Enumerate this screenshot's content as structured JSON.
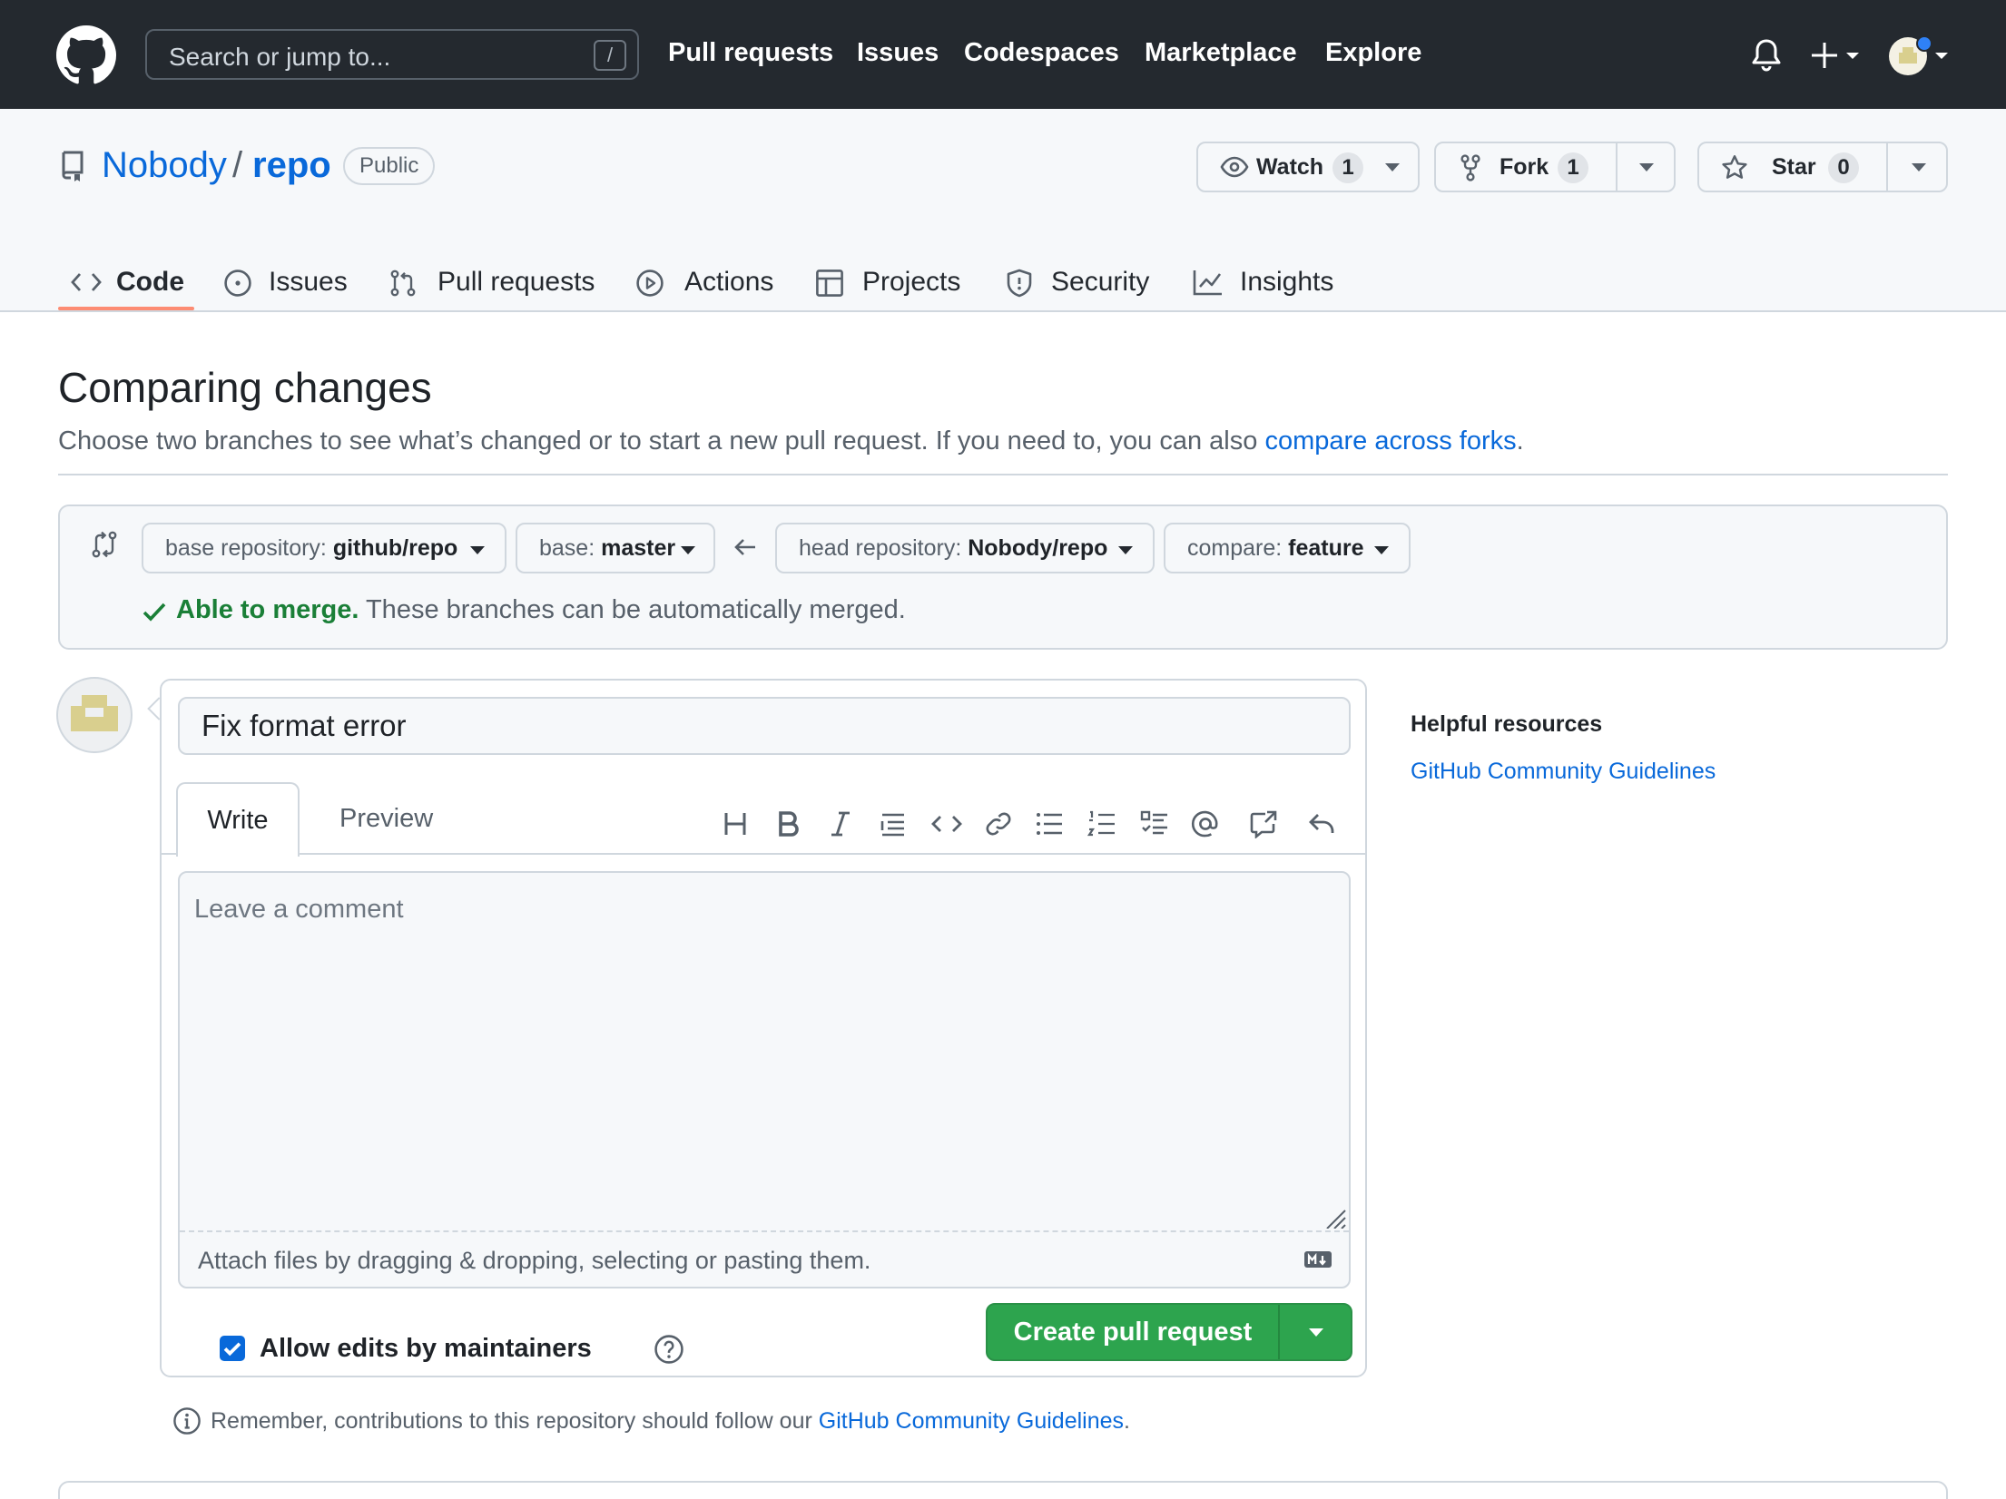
{
  "topbar": {
    "search_placeholder": "Search or jump to...",
    "search_key": "/",
    "nav": [
      "Pull requests",
      "Issues",
      "Codespaces",
      "Marketplace",
      "Explore"
    ]
  },
  "repo": {
    "owner": "Nobody",
    "separator": "/",
    "name": "repo",
    "visibility": "Public",
    "watch": {
      "label": "Watch",
      "count": "1"
    },
    "fork": {
      "label": "Fork",
      "count": "1"
    },
    "star": {
      "label": "Star",
      "count": "0"
    }
  },
  "tabs": [
    "Code",
    "Issues",
    "Pull requests",
    "Actions",
    "Projects",
    "Security",
    "Insights"
  ],
  "active_tab": "Code",
  "main": {
    "title": "Comparing changes",
    "subtitle_text": "Choose two branches to see what’s changed or to start a new pull request. If you need to, you can also ",
    "subtitle_link": "compare across forks",
    "subtitle_end": "."
  },
  "range": {
    "base_repo_label": "base repository: ",
    "base_repo_value": "github/repo",
    "base_label": "base: ",
    "base_value": "master",
    "head_repo_label": "head repository: ",
    "head_repo_value": "Nobody/repo",
    "compare_label": "compare: ",
    "compare_value": "feature",
    "merge_ok": "Able to merge.",
    "merge_text": " These branches can be automatically merged."
  },
  "compose": {
    "title_value": "Fix format error",
    "tab_write": "Write",
    "tab_preview": "Preview",
    "comment_placeholder": "Leave a comment",
    "attach_text": "Attach files by dragging & dropping, selecting or pasting them.",
    "allow_edits_label": "Allow edits by maintainers",
    "allow_edits_checked": true,
    "create_button": "Create pull request"
  },
  "remember": {
    "text": "Remember, contributions to this repository should follow our ",
    "link": "GitHub Community Guidelines",
    "end": "."
  },
  "sidebar": {
    "heading": "Helpful resources",
    "link": "GitHub Community Guidelines"
  },
  "colors": {
    "header_bg": "#24292f",
    "link": "#0969da",
    "success": "#1a7f37",
    "primary_button": "#2da44e",
    "tab_underline": "#fd8c73"
  }
}
